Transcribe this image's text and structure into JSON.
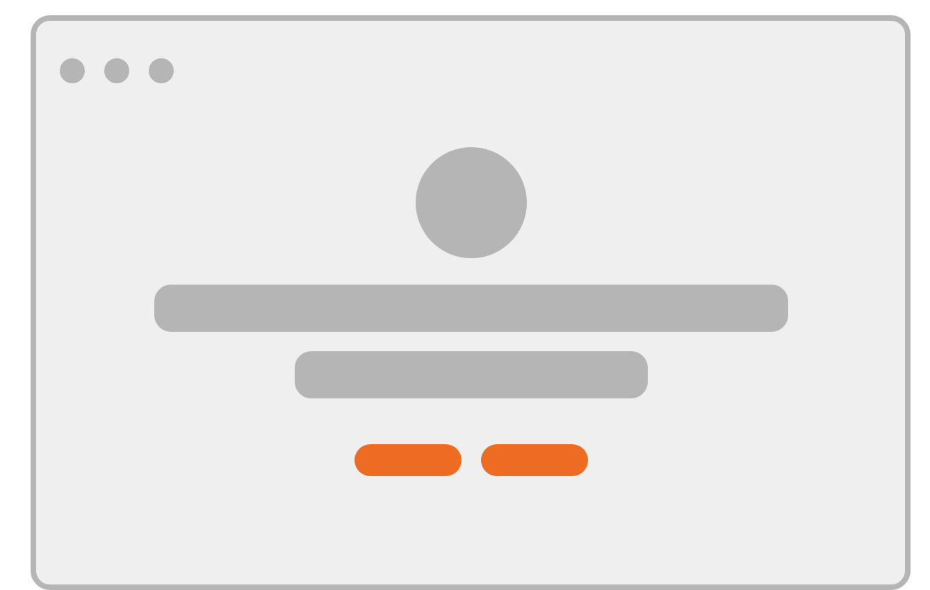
{
  "window": {
    "controls": [
      {
        "kind": "dot"
      },
      {
        "kind": "dot"
      },
      {
        "kind": "dot"
      }
    ]
  },
  "content": [
    {
      "kind": "avatar"
    },
    {
      "kind": "headline"
    },
    {
      "kind": "subline"
    },
    {
      "kind": "buttons",
      "buttons": [
        {
          "kind": "button"
        },
        {
          "kind": "button"
        }
      ]
    }
  ]
}
